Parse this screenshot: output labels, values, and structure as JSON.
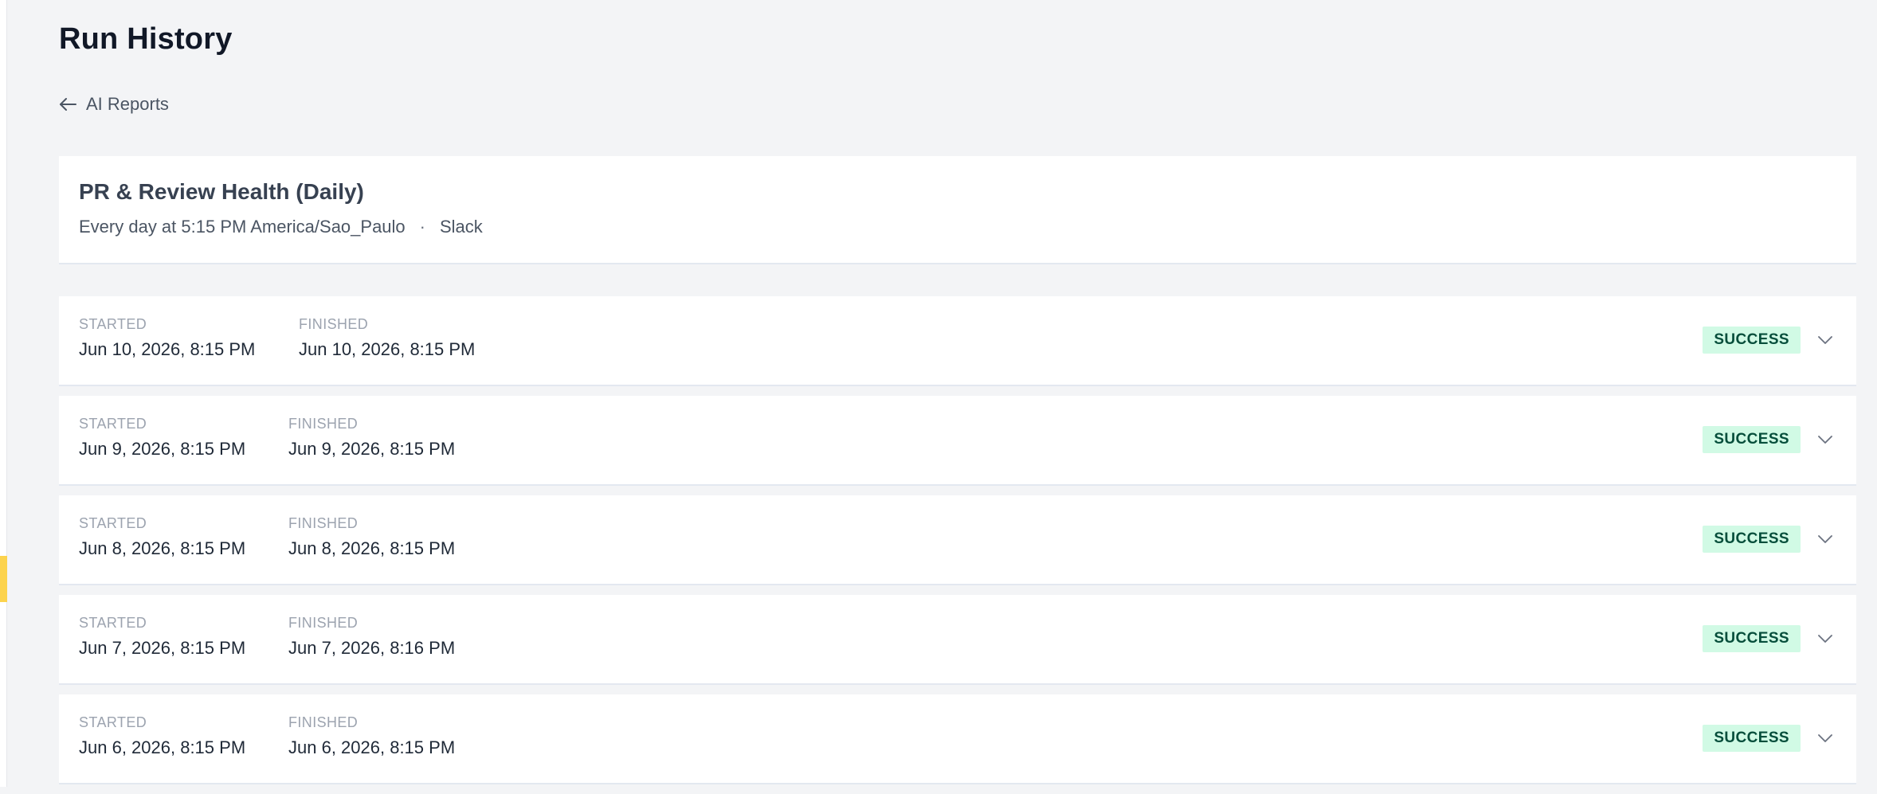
{
  "page": {
    "title": "Run History",
    "back_label": "AI Reports"
  },
  "report": {
    "title": "PR & Review Health (Daily)",
    "schedule": "Every day at 5:15 PM America/Sao_Paulo",
    "separator": "·",
    "destination": "Slack"
  },
  "labels": {
    "started": "STARTED",
    "finished": "FINISHED"
  },
  "runs": [
    {
      "started": "Jun 10, 2026, 8:15 PM",
      "finished": "Jun 10, 2026, 8:15 PM",
      "status": "SUCCESS"
    },
    {
      "started": "Jun 9, 2026, 8:15 PM",
      "finished": "Jun 9, 2026, 8:15 PM",
      "status": "SUCCESS"
    },
    {
      "started": "Jun 8, 2026, 8:15 PM",
      "finished": "Jun 8, 2026, 8:15 PM",
      "status": "SUCCESS"
    },
    {
      "started": "Jun 7, 2026, 8:15 PM",
      "finished": "Jun 7, 2026, 8:16 PM",
      "status": "SUCCESS"
    },
    {
      "started": "Jun 6, 2026, 8:15 PM",
      "finished": "Jun 6, 2026, 8:15 PM",
      "status": "SUCCESS"
    }
  ],
  "icons": {
    "back": "arrow-left-icon",
    "expand": "chevron-down-icon"
  },
  "colors": {
    "success_bg": "#d1fae5",
    "success_text": "#064e3b",
    "rail_indicator": "#fcd34d"
  }
}
